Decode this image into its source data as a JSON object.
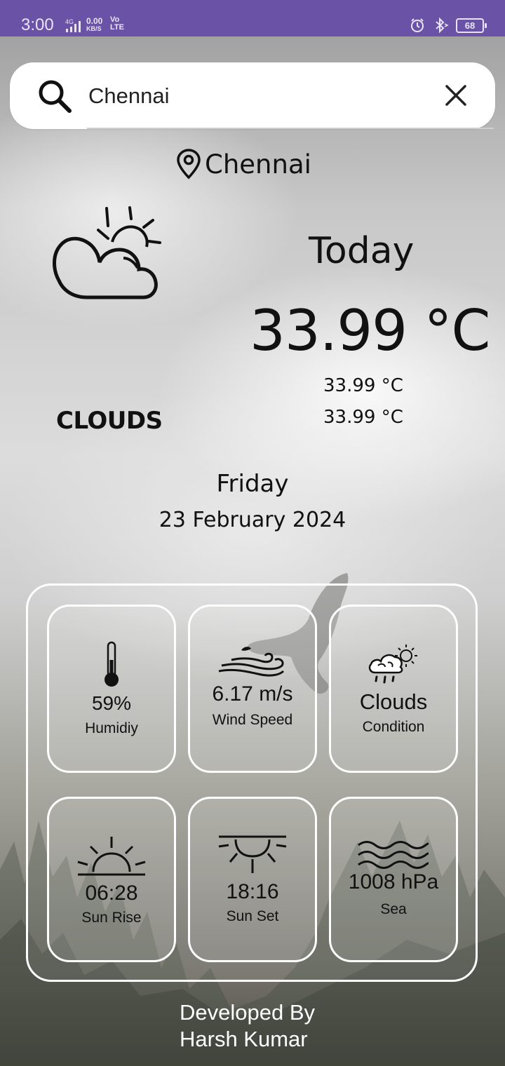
{
  "status_bar": {
    "time": "3:00",
    "network_type": "4G",
    "data_rate": "0.00",
    "data_rate_unit": "KB/S",
    "volte_top": "Vo",
    "volte_bottom": "LTE",
    "battery": "68",
    "icons": [
      "signal-icon",
      "alarm-icon",
      "bluetooth-icon",
      "battery-icon"
    ],
    "color": "#6a52a6"
  },
  "search": {
    "value": "Chennai",
    "icons": [
      "search-icon",
      "close-icon"
    ]
  },
  "location": {
    "city": "Chennai",
    "icon": "location-pin-icon"
  },
  "weather": {
    "icon": "partly-cloudy-icon",
    "condition": "CLOUDS",
    "today_label": "Today",
    "temperature": "33.99 °C",
    "temp_min": "33.99 °C",
    "temp_max": "33.99 °C"
  },
  "date": {
    "day": "Friday",
    "full_date": "23 February 2024"
  },
  "details": [
    {
      "value": "59%",
      "label": "Humidiy",
      "icon": "thermometer-icon"
    },
    {
      "value": "6.17 m/s",
      "label": "Wind Speed",
      "icon": "wind-icon"
    },
    {
      "value": "Clouds",
      "label": "Condition",
      "icon": "cloud-rain-sun-icon"
    },
    {
      "value": "06:28",
      "label": "Sun Rise",
      "icon": "sunrise-icon"
    },
    {
      "value": "18:16",
      "label": "Sun Set",
      "icon": "sunset-icon"
    },
    {
      "value": "1008 hPa",
      "label": "Sea",
      "icon": "waves-icon"
    }
  ],
  "footer": {
    "line1": "Developed By",
    "line2": "Harsh Kumar"
  }
}
